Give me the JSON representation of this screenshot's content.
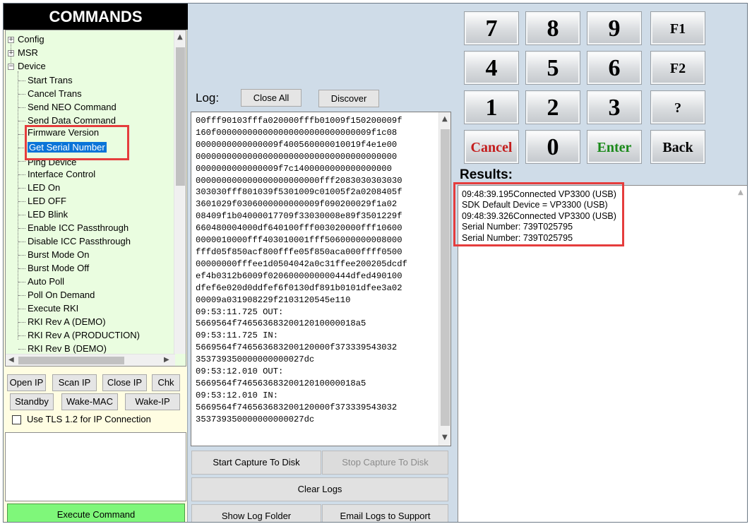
{
  "left_panel": {
    "title": "COMMANDS",
    "tree": {
      "roots": [
        {
          "label": "Config",
          "expanded": false
        },
        {
          "label": "MSR",
          "expanded": false
        },
        {
          "label": "Device",
          "expanded": true
        }
      ],
      "device_items": [
        "Start Trans",
        "Cancel Trans",
        "Send NEO Command",
        "Send Data Command",
        "Firmware Version",
        "Get Serial Number",
        "Ping Device",
        "Interface Control",
        "LED On",
        "LED OFF",
        "LED Blink",
        "Enable ICC Passthrough",
        "Disable ICC Passthrough",
        "Burst Mode On",
        "Burst Mode Off",
        "Auto Poll",
        "Poll On Demand",
        "Execute RKI",
        "RKI Rev A (DEMO)",
        "RKI Rev A (PRODUCTION)",
        "RKI Rev B (DEMO)"
      ],
      "selected": "Get Serial Number"
    },
    "buttons": {
      "open_ip": "Open IP",
      "scan_ip": "Scan IP",
      "close_ip": "Close IP",
      "chk": "Chk",
      "standby": "Standby",
      "wake_mac": "Wake-MAC",
      "wake_ip": "Wake-IP"
    },
    "tls_checkbox": {
      "label": "Use TLS 1.2 for IP Connection",
      "checked": false
    },
    "execute_button": "Execute Command"
  },
  "log": {
    "label": "Log:",
    "close_all": "Close All",
    "discover": "Discover",
    "lines": [
      "00fff90103fffa020000fffb01009f150200009f",
      "160f000000000000000000000000000009f1c08",
      "0000000000000009f400560000010019f4e1e00",
      "000000000000000000000000000000000000000",
      "0000000000000009f7c1400000000000000000",
      "000000000000000000000000fff2083030303030",
      "303030fff801039f5301009c01005f2a0208405f",
      "3601029f0306000000000009f090200029f1a02",
      "08409f1b04000017709f33030008e89f3501229f",
      "660480004000df640100fff003020000fff10600",
      "0000010000fff403010001fff506000000008000",
      "fffd05f850acf800fffe05f850aca000ffff0500",
      "00000000fffee1d0504042a0c31ffee200205dcdf",
      "ef4b0312b6009f0206000000000444dfed490100",
      "dfef6e020d0ddfef6f0130df891b0101dfee3a02",
      "00009a031908229f2103120545e110",
      "09:53:11.725 OUT:",
      "5669564f74656368320012010000018a5",
      "09:53:11.725 IN:",
      "5669564f746563683200120000f373339543032",
      "353739350000000000027dc",
      "09:53:12.010 OUT:",
      "5669564f74656368320012010000018a5",
      "09:53:12.010 IN:",
      "5669564f746563683200120000f373339543032",
      "353739350000000000027dc"
    ],
    "buttons": {
      "start_capture": "Start Capture To Disk",
      "stop_capture": "Stop Capture To Disk",
      "clear_logs": "Clear Logs",
      "show_log_folder": "Show Log Folder",
      "email_logs": "Email Logs to Support"
    }
  },
  "keypad": {
    "rows": [
      [
        "7",
        "8",
        "9",
        "F1"
      ],
      [
        "4",
        "5",
        "6",
        "F2"
      ],
      [
        "1",
        "2",
        "3",
        "?"
      ],
      [
        "Cancel",
        "0",
        "Enter",
        "Back"
      ]
    ]
  },
  "results": {
    "label": "Results:",
    "lines": [
      "09:48:39.195Connected VP3300 (USB)",
      "SDK Default Device =  VP3300 (USB)",
      "09:48:39.326Connected VP3300 (USB)",
      "Serial Number: 739T025795",
      "Serial Number: 739T025795"
    ]
  },
  "colors": {
    "highlight": "#e53d3d",
    "execute_button": "#7ff77a",
    "tree_background": "#eafde0",
    "window_background": "#cfdce8",
    "selection": "#0a74d8"
  }
}
